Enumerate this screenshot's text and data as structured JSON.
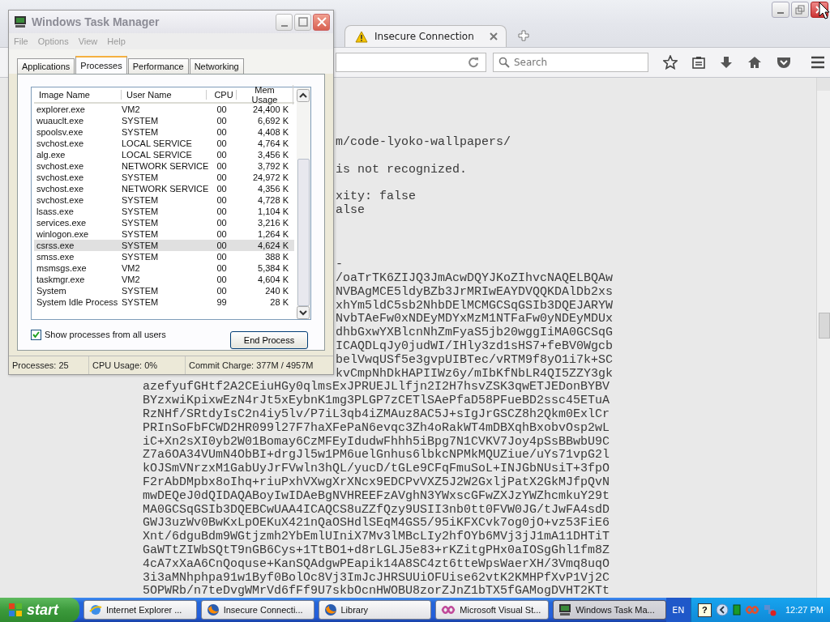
{
  "browser": {
    "tabs": [
      {
        "title": "Insecure Connection",
        "selected": true
      }
    ],
    "search": {
      "placeholder": "Search"
    },
    "document": {
      "behind_window_blocks": [
        [
          "m/code-lyoko-wallpapers/"
        ],
        [
          "is not recognized."
        ],
        [
          "xity: false",
          "alse"
        ],
        [
          "-",
          "/oaTrTK6ZIJQ3JmAcwDQYJKoZIhvcNAQELBQAw",
          "NVBAgMCE5ldyBZb3JrMRIwEAYDVQQKDAlDb2xs",
          "xhYm5ldC5sb2NhbDElMCMGCSqGSIb3DQEJARYW",
          "NvbTAeFw0xNDEyMDYxMzM1NTFaFw0yNDEyMDUx",
          "dhbGxwYXBlcnNhZmFyaS5jb20wggIiMA0GCSqG",
          "ICAQDLqJy0judWI/IHly3zd1sHS7+feBV0Wgcb",
          "belVwqUSf5e3gvpUIBTec/vRTM9f8yO1i7k+SC",
          "kvCmpNhDkHAPIIWz6y/mIbKfNbLR4QI5ZZY3gk"
        ]
      ],
      "lines": [
        "azefyufGHtf2A2CEiuHGy0qlmsExJPRUEJLlfjn2I2H7hsvZSK3qwETJEDonBYBV",
        "BYzxwiKpixwEzN4rJt5xEybnK1mg3PLGP7zCETlSAePfaD58PFueBD2ssc45ETuA",
        "RzNHf/SRtdyIsC2n4iy5lv/P7iL3qb4iZMAuz8AC5J+sIgJrGSCZ8h2Qkm0ExlCr",
        "PRInSoFbFCWD2HR099l27F7haXFePaN6evqc3Zh4oRakWT4mDBXqhBxobvOsp2wL",
        "iC+Xn2sXI0yb2W01Bomay6CzMFEyIdudwFhhh5iBpg7N1CVKV7Joy4pSsBBwbU9C",
        "Z7a6OA34VUmN4ObBI+drgJl5w1PM6uelGnhus6lbkcNPMkMQUZiue/uYs71vpG2l",
        "kOJSmVNrzxM1GabUyJrFVwln3hQL/yucD/tGLe9CFqFmuSoL+INJGbNUsiT+3fpO",
        "F2rAbDMpbx8oIhq+riuPxhVXwgXrXNcx9EDCPvVXZ5J2W2GxljPatX2GkMJfpQvN",
        "mwDEQeJ0dQIDAQABoyIwIDAeBgNVHREEFzAVghN3YWxscGFwZXJzYWZhcmkuY29t",
        "MA0GCSqGSIb3DQEBCwUAA4ICAQCS8uZZfQzy9USII3nb0tt0FVW0JG/tJwFA4sdD",
        "GWJ3uzWv0BwKxLpOEKuX421nQaOSHdlSEqM4GS5/95iKFXCvk7og0jO+vz53FiE6",
        "Xnt/6dguBdm9WGtjzmh2YbEmlUIniX7Mv3lMBcLIy2hfOYb6MVj3jJ1mA11DHTiT",
        "GaWTtZIWbSQtT9nGB6Cys+1TtBO1+d8rLGLJ5e83+rKZitgPHx0aIOSgGhl1fm8Z",
        "4cA7xXaA6CnQoquse+KanSQAdgwPEapik14A8SC4zt6tteWpsWaerXH/3Vmq8uqO",
        "3i3aMNhphpa91w1Byf0BolOc8Vj3ImJcJHRSUUiOFUise62vtK2KMHPfXvP1Vj2C",
        "5OPWRb/n7teDvgWMrVd6fFf9U7skbOcnHWOBU8zorZJnZ1bTX5fGAMogDVHT2KTt"
      ]
    }
  },
  "task_manager": {
    "title": "Windows Task Manager",
    "menu": [
      "File",
      "Options",
      "View",
      "Help"
    ],
    "tabs": [
      {
        "label": "Applications",
        "selected": false
      },
      {
        "label": "Processes",
        "selected": true
      },
      {
        "label": "Performance",
        "selected": false
      },
      {
        "label": "Networking",
        "selected": false
      }
    ],
    "table": {
      "columns": [
        "Image Name",
        "User Name",
        "CPU",
        "Mem Usage"
      ],
      "rows": [
        {
          "cells": [
            "explorer.exe",
            "VM2",
            "00",
            "24,400 K"
          ],
          "selected": false
        },
        {
          "cells": [
            "wuauclt.exe",
            "SYSTEM",
            "00",
            "6,692 K"
          ],
          "selected": false
        },
        {
          "cells": [
            "spoolsv.exe",
            "SYSTEM",
            "00",
            "4,408 K"
          ],
          "selected": false
        },
        {
          "cells": [
            "svchost.exe",
            "LOCAL SERVICE",
            "00",
            "4,764 K"
          ],
          "selected": false
        },
        {
          "cells": [
            "alg.exe",
            "LOCAL SERVICE",
            "00",
            "3,456 K"
          ],
          "selected": false
        },
        {
          "cells": [
            "svchost.exe",
            "NETWORK SERVICE",
            "00",
            "3,792 K"
          ],
          "selected": false
        },
        {
          "cells": [
            "svchost.exe",
            "SYSTEM",
            "00",
            "24,972 K"
          ],
          "selected": false
        },
        {
          "cells": [
            "svchost.exe",
            "NETWORK SERVICE",
            "00",
            "4,356 K"
          ],
          "selected": false
        },
        {
          "cells": [
            "svchost.exe",
            "SYSTEM",
            "00",
            "4,728 K"
          ],
          "selected": false
        },
        {
          "cells": [
            "lsass.exe",
            "SYSTEM",
            "00",
            "1,104 K"
          ],
          "selected": false
        },
        {
          "cells": [
            "services.exe",
            "SYSTEM",
            "00",
            "3,216 K"
          ],
          "selected": false
        },
        {
          "cells": [
            "winlogon.exe",
            "SYSTEM",
            "00",
            "1,264 K"
          ],
          "selected": false
        },
        {
          "cells": [
            "csrss.exe",
            "SYSTEM",
            "00",
            "4,624 K"
          ],
          "selected": true
        },
        {
          "cells": [
            "smss.exe",
            "SYSTEM",
            "00",
            "388 K"
          ],
          "selected": false
        },
        {
          "cells": [
            "msmsgs.exe",
            "VM2",
            "00",
            "5,384 K"
          ],
          "selected": false
        },
        {
          "cells": [
            "taskmgr.exe",
            "VM2",
            "00",
            "4,604 K"
          ],
          "selected": false
        },
        {
          "cells": [
            "System",
            "SYSTEM",
            "00",
            "240 K"
          ],
          "selected": false
        },
        {
          "cells": [
            "System Idle Process",
            "SYSTEM",
            "99",
            "28 K"
          ],
          "selected": false
        }
      ]
    },
    "show_all_users": {
      "label": "Show processes from all users",
      "checked": true
    },
    "end_button": "End Process",
    "status": [
      "Processes: 25",
      "CPU Usage: 0%",
      "Commit Charge: 377M / 4957M"
    ]
  },
  "taskbar": {
    "start": "start",
    "items": [
      {
        "label": "Internet Explorer ...",
        "kind": "ie",
        "selected": false
      },
      {
        "label": "Insecure Connecti...",
        "kind": "firefox",
        "selected": false
      },
      {
        "label": "Library",
        "kind": "firefox",
        "selected": false
      },
      {
        "label": "Microsoft Visual St...",
        "kind": "vs",
        "selected": false
      },
      {
        "label": "Windows Task Ma...",
        "kind": "taskmgr",
        "selected": true
      }
    ],
    "language": "EN",
    "help": "?",
    "clock": "12:27 PM"
  }
}
